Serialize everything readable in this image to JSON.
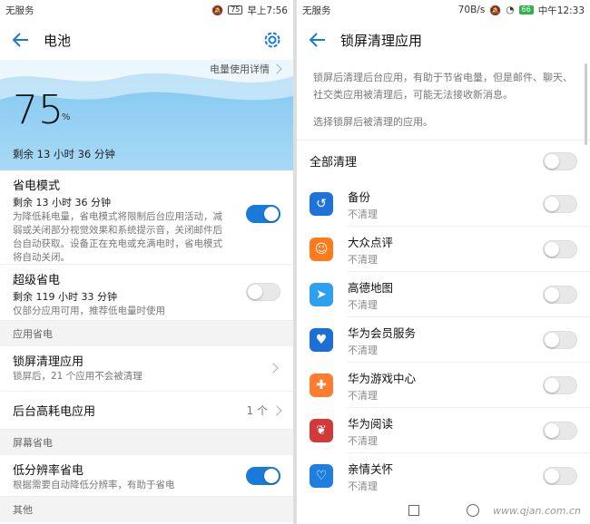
{
  "left": {
    "status": {
      "carrier": "无服务",
      "battery": "75",
      "time": "早上7:56"
    },
    "title": "电池",
    "hero": {
      "usage_link": "电量使用详情",
      "percent": "75",
      "percent_sign": "%",
      "remaining": "剩余 13 小时 36 分钟"
    },
    "power_saving": {
      "title": "省电模式",
      "sub": "剩余 13 小时 36 分钟",
      "desc": "为降低耗电量，省电模式将限制后台应用活动，减弱或关闭部分视觉效果和系统提示音，关闭邮件后台自动获取。设备正在充电或充满电时，省电模式将自动关闭。",
      "enabled": true
    },
    "super_saving": {
      "title": "超级省电",
      "sub": "剩余 119 小时 33 分钟",
      "desc": "仅部分应用可用，推荐低电量时使用",
      "enabled": false
    },
    "section_app": "应用省电",
    "lock_clean": {
      "title": "锁屏清理应用",
      "desc": "锁屏后，21 个应用不会被清理"
    },
    "bg_high": {
      "title": "后台高耗电应用",
      "value": "1 个"
    },
    "section_screen": "屏幕省电",
    "low_res": {
      "title": "低分辨率省电",
      "desc": "根据需要自动降低分辨率，有助于省电",
      "enabled": true
    },
    "section_other": "其他"
  },
  "right": {
    "status": {
      "carrier": "无服务",
      "speed": "70B/s",
      "battery": "66",
      "time": "中午12:33"
    },
    "title": "锁屏清理应用",
    "info": "锁屏后清理后台应用，有助于节省电量，但是邮件、聊天、社交类应用被清理后，可能无法接收新消息。",
    "info2": "选择锁屏后被清理的应用。",
    "all_label": "全部清理",
    "apps": [
      {
        "name": "备份",
        "state": "不清理",
        "color": "#1e73d8",
        "glyph": "↺"
      },
      {
        "name": "大众点评",
        "state": "不清理",
        "color": "#ff7a1a",
        "glyph": "☺"
      },
      {
        "name": "高德地图",
        "state": "不清理",
        "color": "#2f9ff0",
        "glyph": "➤"
      },
      {
        "name": "华为会员服务",
        "state": "不清理",
        "color": "#1c6fd6",
        "glyph": "♥"
      },
      {
        "name": "华为游戏中心",
        "state": "不清理",
        "color": "#ff7b2e",
        "glyph": "✚"
      },
      {
        "name": "华为阅读",
        "state": "不清理",
        "color": "#d23a3a",
        "glyph": "❦"
      },
      {
        "name": "亲情关怀",
        "state": "不清理",
        "color": "#1f7fe0",
        "glyph": "♡"
      }
    ],
    "watermark": "www.qjan.com.cn"
  }
}
